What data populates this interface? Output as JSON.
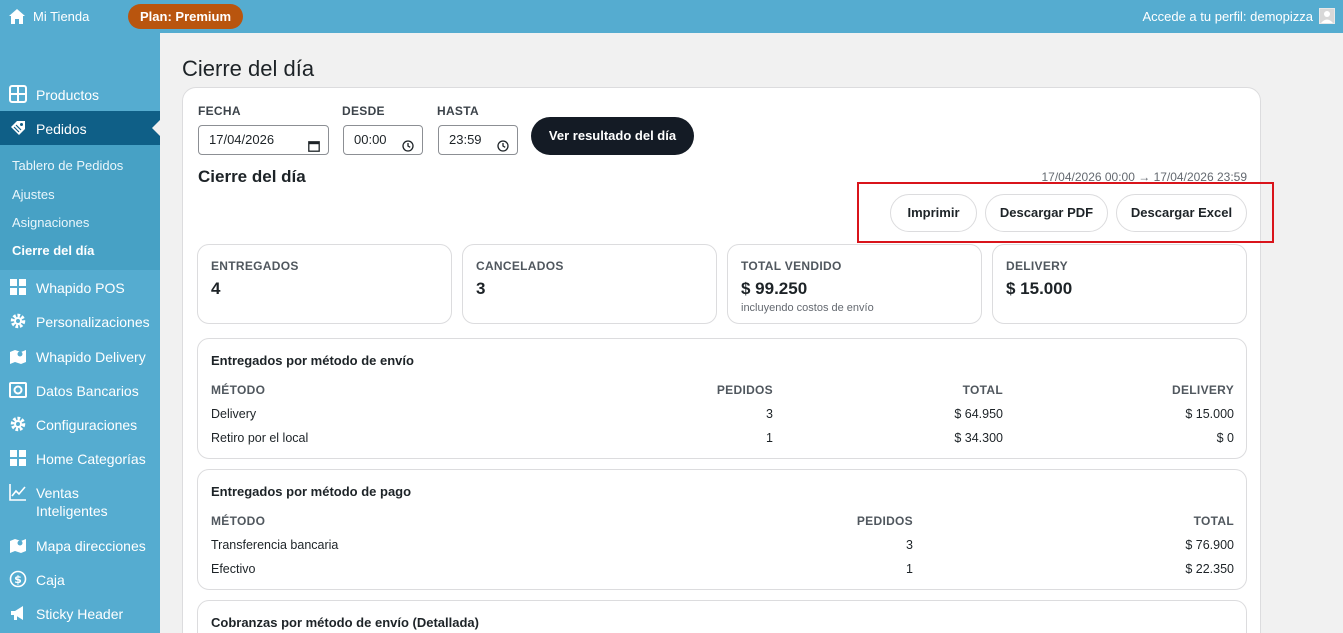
{
  "topbar": {
    "site_name": "Mi Tienda",
    "plan_badge": "Plan: Premium",
    "profile_text": "Accede a tu perfil: demopizza"
  },
  "sidebar": {
    "items": [
      {
        "label": "Productos",
        "icon": "grid-icon"
      },
      {
        "label": "Pedidos",
        "icon": "tag-icon"
      },
      {
        "label": "Whapido POS",
        "icon": "dashboard-icon"
      },
      {
        "label": "Personalizaciones",
        "icon": "gear-icon"
      },
      {
        "label": "Whapido Delivery",
        "icon": "map-icon"
      },
      {
        "label": "Datos Bancarios",
        "icon": "vault-icon"
      },
      {
        "label": "Configuraciones",
        "icon": "gear-icon"
      },
      {
        "label": "Home Categorías",
        "icon": "dashboard-icon"
      },
      {
        "label": "Ventas Inteligentes",
        "label_line1": "Ventas",
        "label_line2": "Inteligentes",
        "icon": "chart-icon"
      },
      {
        "label": "Mapa direcciones",
        "icon": "map-icon"
      },
      {
        "label": "Caja",
        "icon": "dollar-icon"
      },
      {
        "label": "Sticky Header",
        "icon": "megaphone-icon"
      }
    ],
    "submenu": [
      "Tablero de Pedidos",
      "Ajustes",
      "Asignaciones",
      "Cierre del día"
    ]
  },
  "page": {
    "title": "Cierre del día",
    "filters": {
      "fecha_label": "FECHA",
      "fecha_value": "17/04/2026",
      "desde_label": "DESDE",
      "desde_value": "00:00",
      "hasta_label": "HASTA",
      "hasta_value": "23:59",
      "submit_label": "Ver resultado del día"
    },
    "section_title": "Cierre del día",
    "range": "17/04/2026 00:00 → 17/04/2026 23:59",
    "actions": {
      "print": "Imprimir",
      "pdf": "Descargar PDF",
      "excel": "Descargar Excel"
    },
    "stats": [
      {
        "label": "ENTREGADOS",
        "value": "4"
      },
      {
        "label": "CANCELADOS",
        "value": "3"
      },
      {
        "label": "TOTAL VENDIDO",
        "value": "$ 99.250",
        "note": "incluyendo costos de envío"
      },
      {
        "label": "DELIVERY",
        "value": "$ 15.000"
      }
    ],
    "by_shipping": {
      "title": "Entregados por método de envío",
      "headers": [
        "MÉTODO",
        "PEDIDOS",
        "TOTAL",
        "DELIVERY"
      ],
      "rows": [
        [
          "Delivery",
          "3",
          "$ 64.950",
          "$ 15.000"
        ],
        [
          "Retiro por el local",
          "1",
          "$ 34.300",
          "$ 0"
        ]
      ]
    },
    "by_payment": {
      "title": "Entregados por método de pago",
      "headers": [
        "MÉTODO",
        "PEDIDOS",
        "TOTAL"
      ],
      "rows": [
        [
          "Transferencia bancaria",
          "3",
          "$ 76.900"
        ],
        [
          "Efectivo",
          "1",
          "$ 22.350"
        ]
      ]
    },
    "collections": {
      "title": "Cobranzas por método de envío (Detallada)"
    }
  }
}
